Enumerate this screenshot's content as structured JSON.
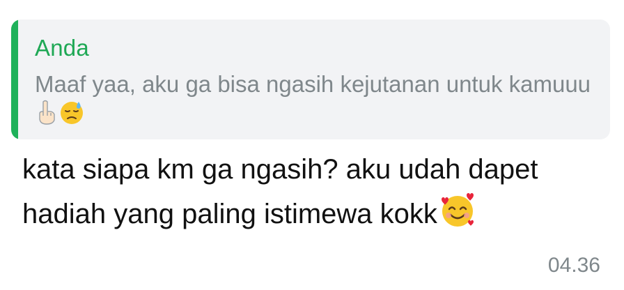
{
  "reply_quote": {
    "author": "Anda",
    "text": "Maaf yaa, aku ga bisa ngasih kejutanan untuk kamuuu",
    "emojis": [
      "index-finger-up-emoji",
      "sad-sweat-face-emoji"
    ],
    "accent_color": "#1fb15a"
  },
  "message": {
    "text": "kata siapa km ga ngasih? aku udah dapet hadiah yang paling istimewa kokk",
    "emoji": "smiling-face-with-hearts-emoji",
    "timestamp": "04.36"
  }
}
